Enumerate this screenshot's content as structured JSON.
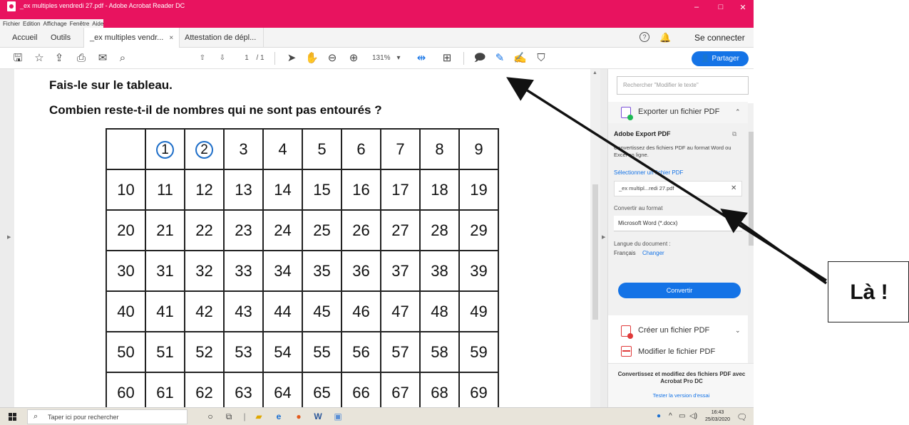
{
  "window": {
    "title": "_ex multiples vendredi 27.pdf - Adobe Acrobat Reader DC",
    "minimize": "–",
    "maximize": "□",
    "close": "✕"
  },
  "menu": [
    "Fichier",
    "Edition",
    "Affichage",
    "Fenêtre",
    "Aide"
  ],
  "tabs": {
    "home": "Accueil",
    "tools": "Outils",
    "doc1": "_ex multiples vendr...",
    "doc1_close": "×",
    "doc2": "Attestation de dépl...",
    "login": "Se connecter"
  },
  "toolbar": {
    "page_current": "1",
    "page_total": "/ 1",
    "zoom": "131%",
    "share": "Partager"
  },
  "document": {
    "heading1": "Fais-le sur le tableau.",
    "heading2": "Combien reste-t-il de nombres qui ne sont pas entourés ?",
    "grid": [
      [
        "",
        "1",
        "2",
        "3",
        "4",
        "5",
        "6",
        "7",
        "8",
        "9"
      ],
      [
        "10",
        "11",
        "12",
        "13",
        "14",
        "15",
        "16",
        "17",
        "18",
        "19"
      ],
      [
        "20",
        "21",
        "22",
        "23",
        "24",
        "25",
        "26",
        "27",
        "28",
        "29"
      ],
      [
        "30",
        "31",
        "32",
        "33",
        "34",
        "35",
        "36",
        "37",
        "38",
        "39"
      ],
      [
        "40",
        "41",
        "42",
        "43",
        "44",
        "45",
        "46",
        "47",
        "48",
        "49"
      ],
      [
        "50",
        "51",
        "52",
        "53",
        "54",
        "55",
        "56",
        "57",
        "58",
        "59"
      ],
      [
        "60",
        "61",
        "62",
        "63",
        "64",
        "65",
        "66",
        "67",
        "68",
        "69"
      ]
    ],
    "circled": [
      "1",
      "2"
    ],
    "circle_color": "#1e6ec8"
  },
  "panel": {
    "search_placeholder": "Rechercher \"Modifier le texte\"",
    "export_row": "Exporter un fichier PDF",
    "export_title": "Adobe Export PDF",
    "export_desc": "Convertissez des fichiers PDF au format Word ou Excel en ligne.",
    "select_file": "Sélectionner un fichier PDF",
    "file_name": "_ex multipl...redi 27.pdf",
    "convert_to": "Convertir au format",
    "format": "Microsoft Word (*.docx)",
    "doc_language": "Langue du document :",
    "language": "Français",
    "change": "Changer",
    "convert_button": "Convertir",
    "create_pdf": "Créer un fichier PDF",
    "edit_pdf": "Modifier le fichier PDF",
    "promo": "Convertissez et modifiez des fichiers PDF avec Acrobat Pro DC",
    "trial": "Tester la version d'essai"
  },
  "taskbar": {
    "search": "Taper ici pour rechercher",
    "time": "16:43",
    "date": "25/03/2020"
  },
  "callout": {
    "text": "Là !"
  },
  "colors": {
    "accent": "#e8135f",
    "primary_button": "#1473e6"
  }
}
